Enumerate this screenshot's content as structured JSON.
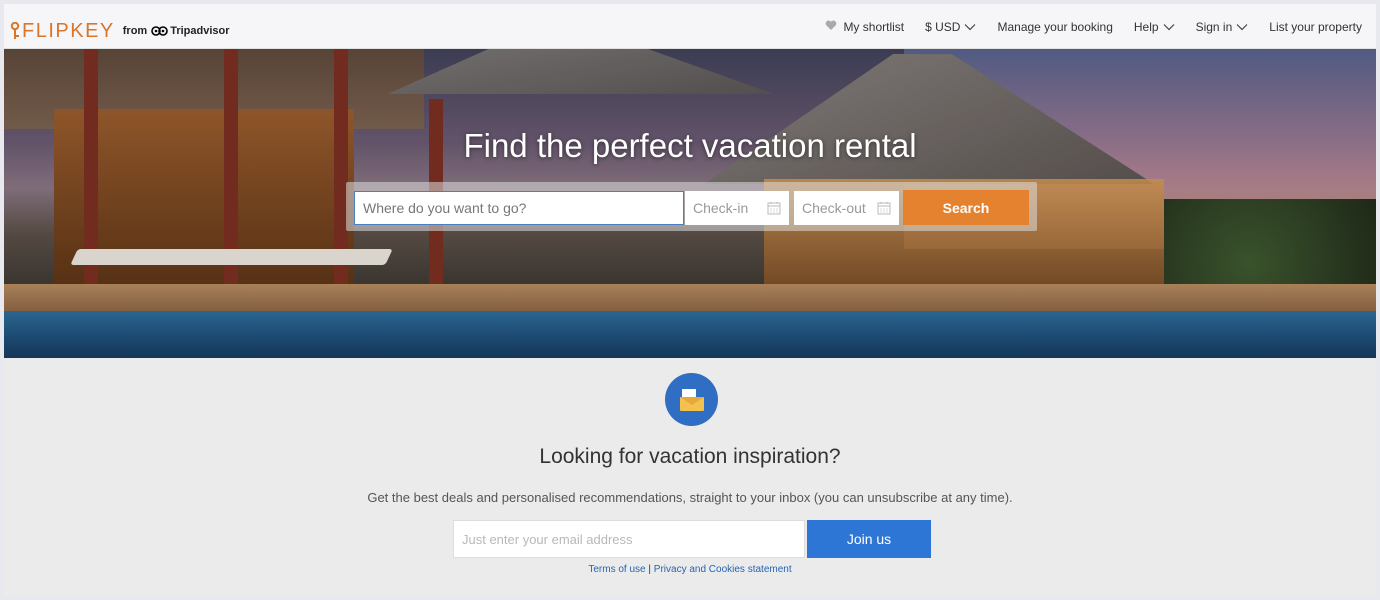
{
  "header": {
    "logo_text": "FLIPKEY",
    "logo_from": "from",
    "logo_partner": "Tripadvisor",
    "nav": {
      "shortlist": "My shortlist",
      "currency": "$ USD",
      "manage_booking": "Manage your booking",
      "help": "Help",
      "sign_in": "Sign in",
      "list_property": "List your property"
    }
  },
  "hero": {
    "title": "Find the perfect vacation rental",
    "search": {
      "where_placeholder": "Where do you want to go?",
      "checkin_placeholder": "Check-in",
      "checkout_placeholder": "Check-out",
      "button_label": "Search"
    }
  },
  "newsletter": {
    "title": "Looking for vacation inspiration?",
    "subtitle": "Get the best deals and personalised recommendations, straight to your inbox (you can unsubscribe at any time).",
    "email_placeholder": "Just enter your email address",
    "button_label": "Join us",
    "terms_label": "Terms of use",
    "separator": "|",
    "privacy_label": "Privacy and Cookies statement"
  },
  "colors": {
    "brand_orange": "#e5822f",
    "join_blue": "#2e76d6",
    "link_blue": "#2764b1"
  },
  "icons": [
    "key-logo-icon",
    "owl-icon",
    "heart-icon",
    "chevron-down-icon",
    "calendar-icon",
    "envelope-icon"
  ]
}
